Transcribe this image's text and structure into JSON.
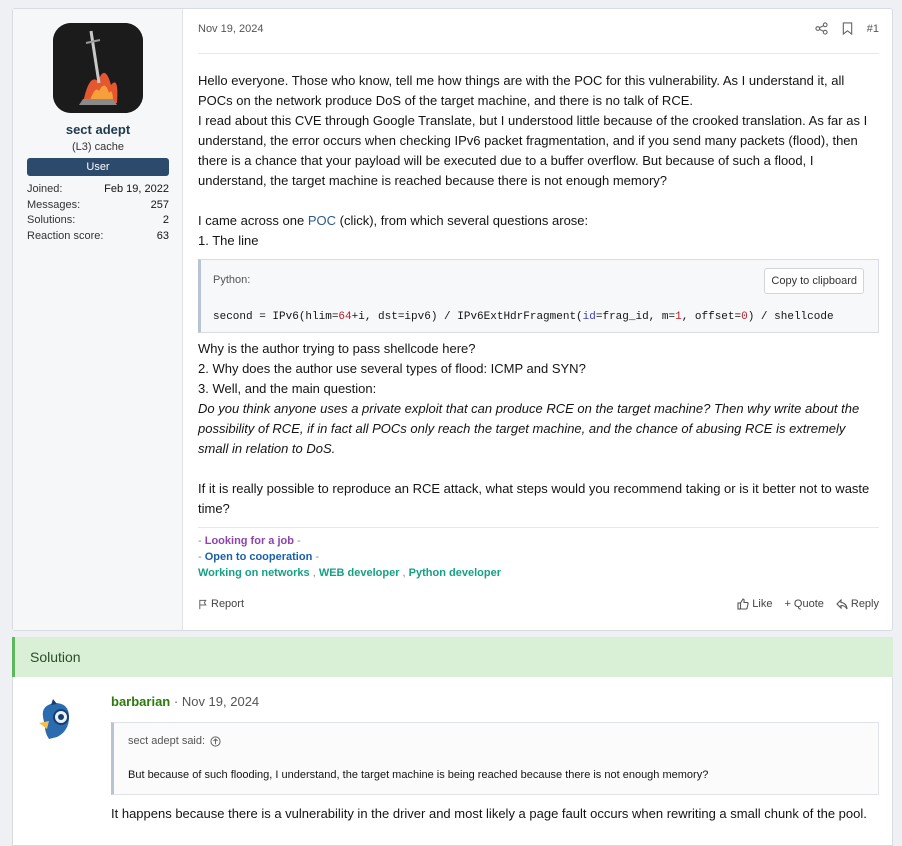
{
  "post": {
    "author": {
      "name": "sect adept",
      "title": "(L3) cache",
      "badge": "User",
      "stats": [
        {
          "label": "Joined:",
          "value": "Feb 19, 2022"
        },
        {
          "label": "Messages:",
          "value": "257"
        },
        {
          "label": "Solutions:",
          "value": "2"
        },
        {
          "label": "Reaction score:",
          "value": "63"
        }
      ]
    },
    "date": "Nov 19, 2024",
    "post_number": "#1",
    "paragraph1": "Hello everyone. Those who know, tell me how things are with the POC for this vulnerability. As I understand it, all POCs on the network produce DoS of the target machine, and there is no talk of RCE.",
    "paragraph2": "I read about this CVE through Google Translate, but I understood little because of the crooked translation. As far as I understand, the error occurs when checking IPv6 packet fragmentation, and if you send many packets (flood), then there is a chance that your payload will be executed due to a buffer overflow. But because of such a flood, I understand, the target machine is reached because there is not enough memory?",
    "came_across_pre": "I came across one ",
    "came_across_link": "POC",
    "came_across_post": " (click), from which several questions arose:",
    "item1": "1. The line",
    "code": {
      "language": "Python:",
      "copy_label": "Copy to clipboard",
      "line": {
        "p1": "second = IPv6(hlim=",
        "n1": "64",
        "p2": "+i, dst=ipv6) / IPv6ExtHdrFragment(",
        "k1": "id",
        "p3": "=frag_id, m=",
        "n2": "1",
        "p4": ", offset=",
        "n3": "0",
        "p5": ") / shellcode"
      }
    },
    "q_shellcode": "Why is the author trying to pass shellcode here?",
    "item2": "2. Why does the author use several types of flood: ICMP and SYN?",
    "item3": "3. Well, and the main question:",
    "italic_question": "Do you think anyone uses a private exploit that can produce RCE on the target machine? Then why write about the possibility of RCE, if in fact all POCs only reach the target machine, and the chance of abusing RCE is extremely small in relation to DoS.",
    "final_question": "If it is really possible to reproduce an RCE attack, what steps would you recommend taking or is it better not to waste time?",
    "signature": {
      "line1": "Looking for a job",
      "line2": "Open to cooperation",
      "line3a": "Working on networks",
      "line3b": "WEB developer",
      "line3c": "Python developer"
    },
    "footer": {
      "report": "Report",
      "like": "Like",
      "quote": "Quote",
      "reply": "Reply"
    }
  },
  "solution_label": "Solution",
  "answer": {
    "author": "barbarian",
    "date": "Nov 19, 2024",
    "quote_author": "sect adept said:",
    "quote_text": "But because of such flooding, I understand, the target machine is being reached because there is not enough memory?",
    "text": "It happens because there is a vulnerability in the driver and most likely a page fault occurs when rewriting a small chunk of the pool."
  },
  "colors": {
    "badge": "#2c4a6b",
    "solution_bg": "#d9f0d6",
    "answer_name": "#2b7a0b",
    "link": "#2b5a83"
  },
  "icons": [
    "share-icon",
    "bookmark-icon",
    "flag-icon",
    "thumbs-up-icon",
    "plus-icon",
    "reply-icon",
    "arrow-up-circle-icon"
  ]
}
